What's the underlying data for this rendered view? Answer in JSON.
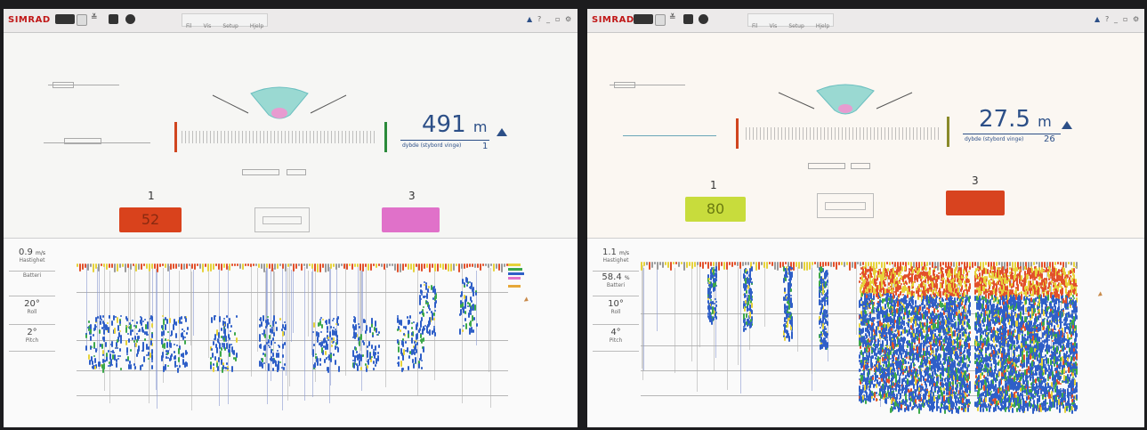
{
  "screens": [
    {
      "app_name": "SIMRAD",
      "menu_items": [
        "Fil",
        "Vis",
        "Setup",
        "Hjelp"
      ],
      "depth_value": "491",
      "depth_unit": "m",
      "depth_label": "dybde (stybord vinge)",
      "depth_index": "1",
      "sensor_numbers": [
        "1",
        "3"
      ],
      "catch_value_1": "52",
      "catch_value_3": "",
      "catch_color_1": "#d9421c",
      "catch_color_3": "#e071c9",
      "sidebar": [
        {
          "value": "0.9",
          "unit": "m/s",
          "label": "Hastighet"
        },
        {
          "value": "",
          "unit": "",
          "label": "Batteri"
        },
        {
          "value": "20°",
          "unit": "",
          "label": "Roll"
        },
        {
          "value": "2°",
          "unit": "",
          "label": "Pitch"
        }
      ]
    },
    {
      "app_name": "SIMRAD",
      "menu_items": [
        "Fil",
        "Vis",
        "Setup",
        "Hjelp"
      ],
      "depth_value": "27.5",
      "depth_unit": "m",
      "depth_label": "dybde (stybord vinge)",
      "depth_index": "26",
      "sensor_numbers": [
        "1",
        "3"
      ],
      "catch_value_1": "80",
      "catch_value_3": "",
      "catch_color_1": "#c8dc3c",
      "catch_color_3": "#d8431f",
      "sidebar": [
        {
          "value": "1.1",
          "unit": "m/s",
          "label": "Hastighet"
        },
        {
          "value": "58.4",
          "unit": "%",
          "label": "Batteri"
        },
        {
          "value": "10°",
          "unit": "",
          "label": "Roll"
        },
        {
          "value": "4°",
          "unit": "",
          "label": "Pitch"
        }
      ]
    }
  ],
  "colors": {
    "depth_text": "#2c4f87",
    "marker_red": "#d0451f",
    "marker_green": "#2a8a3a",
    "echo_blue": "#2f5fc8",
    "echo_green": "#3ca84a",
    "echo_yellow": "#e6d23a",
    "echo_red": "#e2502a"
  }
}
